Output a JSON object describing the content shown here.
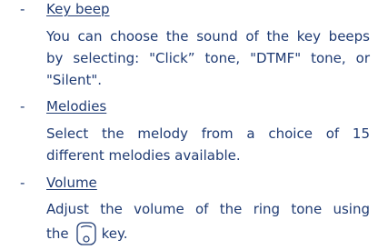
{
  "items": [
    {
      "dash": "-",
      "title": "Key beep",
      "lines": [
        "You can choose the sound of the key beeps",
        "by selecting: \"Click” tone, \"DTMF\" tone, or",
        "\"Silent\"."
      ]
    },
    {
      "dash": "-",
      "title": "Melodies",
      "lines": [
        "Select the melody from a choice of 15",
        "different melodies available."
      ]
    },
    {
      "dash": "-",
      "title": "Volume",
      "lines": [
        "Adjust the volume of the ring tone using"
      ],
      "last_line_before_icon": "the",
      "last_line_after_icon": "key.",
      "icon": "navigation-key-icon"
    }
  ]
}
